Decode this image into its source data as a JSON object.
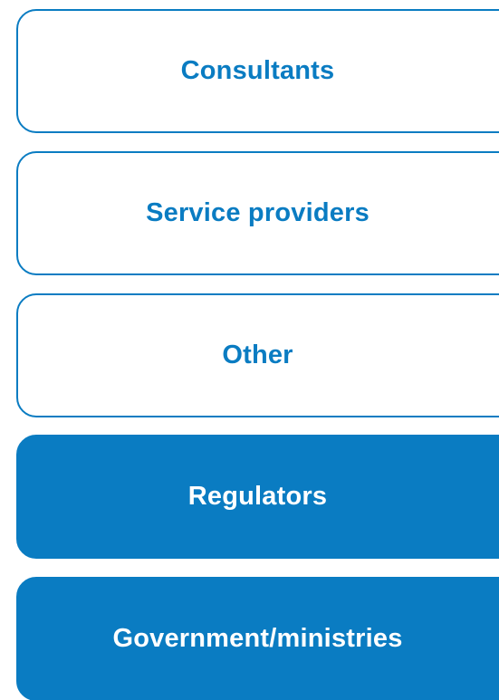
{
  "boxes": [
    {
      "label": "Consultants",
      "style": "outline"
    },
    {
      "label": "Service providers",
      "style": "outline"
    },
    {
      "label": "Other",
      "style": "outline"
    },
    {
      "label": "Regulators",
      "style": "filled"
    },
    {
      "label": "Government/ministries",
      "style": "filled"
    }
  ],
  "colors": {
    "accent": "#0a7cc2",
    "background": "#ffffff",
    "filled_text": "#ffffff"
  }
}
